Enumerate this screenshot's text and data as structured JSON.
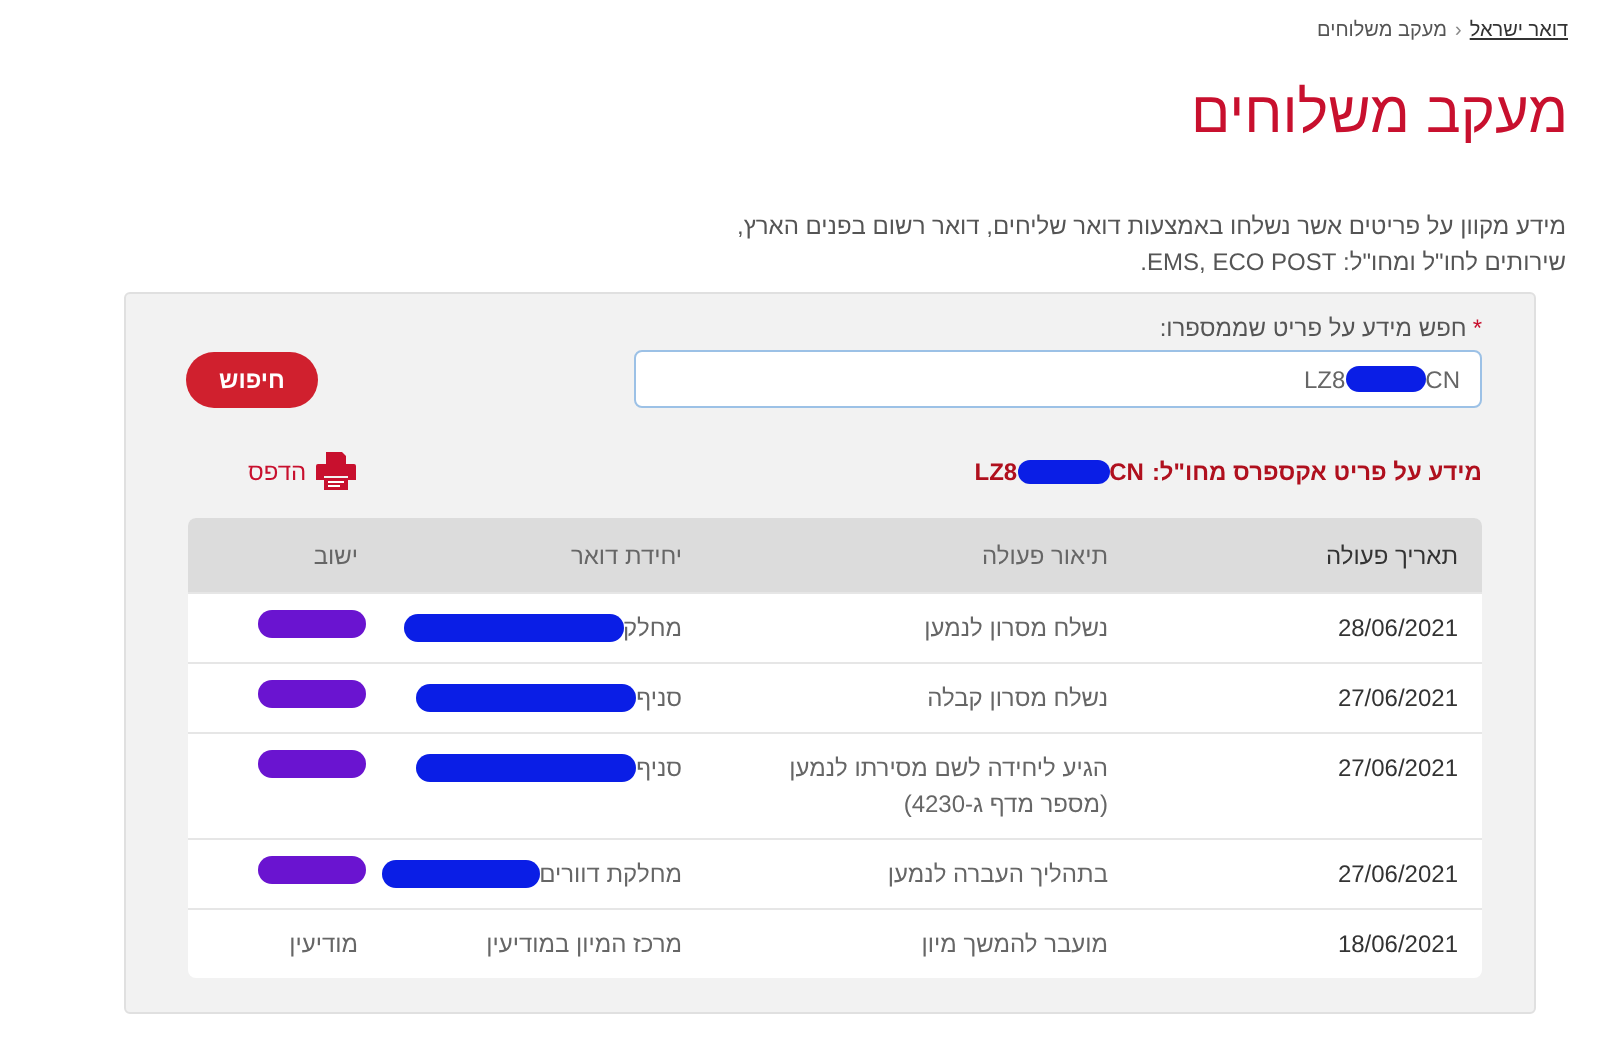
{
  "breadcrumb": [
    {
      "label": "דואר ישראל",
      "link": true
    },
    {
      "label": "מעקב משלוחים",
      "link": false
    }
  ],
  "breadcrumb_separator": "‹",
  "title": "מעקב משלוחים",
  "description": "מידע מקוון על פריטים אשר נשלחו באמצעות דואר שליחים, דואר רשום בפנים הארץ, שירותים לחו\"ל ומחו\"ל: EMS, ECO POST.",
  "search": {
    "label": "חפש מידע על פריט שממספרו:",
    "required_mark": "*",
    "value_start": "LZ8",
    "value_redacted": true,
    "value_end": "CN",
    "button": "חיפוש"
  },
  "print": {
    "label": "הדפס"
  },
  "result_heading": {
    "label": "מידע על פריט אקספרס מחו\"ל:",
    "code_start": "LZ8",
    "code_redacted": true,
    "code_end": "CN"
  },
  "table": {
    "columns": [
      "תאריך פעולה",
      "תיאור פעולה",
      "יחידת דואר",
      "ישוב"
    ],
    "rows": [
      {
        "date": "28/06/2021",
        "action": "נשלח מסרון לנמען",
        "unit": {
          "text": "מחלק",
          "redacted": true
        },
        "settlement": {
          "redacted": true
        }
      },
      {
        "date": "27/06/2021",
        "action": "נשלח מסרון קבלה",
        "unit": {
          "text": "סניף",
          "redacted": true
        },
        "settlement": {
          "redacted": true
        }
      },
      {
        "date": "27/06/2021",
        "action": "הגיע ליחידה לשם מסירתו לנמען (מספר מדף ג-4230)",
        "unit": {
          "text": "סניף",
          "redacted": true
        },
        "settlement": {
          "redacted": true
        }
      },
      {
        "date": "27/06/2021",
        "action": "בתהליך העברה לנמען",
        "unit": {
          "text": "מחלקת דוורים",
          "redacted": true
        },
        "settlement": {
          "redacted": true
        }
      },
      {
        "date": "18/06/2021",
        "action": "מועבר להמשך מיון",
        "unit": {
          "text": "מרכז המיון במודיעין",
          "redacted": false
        },
        "settlement": {
          "text": "מודיעין",
          "redacted": false
        }
      }
    ]
  }
}
